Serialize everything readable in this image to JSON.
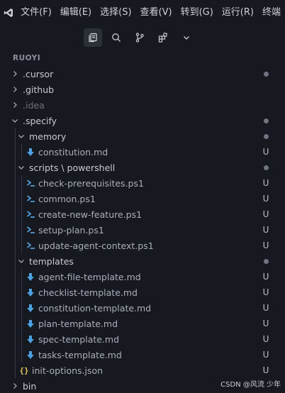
{
  "menubar": {
    "items": [
      "文件(F)",
      "编辑(E)",
      "选择(S)",
      "查看(V)",
      "转到(G)",
      "运行(R)",
      "终端"
    ]
  },
  "toolbar": {
    "icons": [
      "explorer-icon",
      "search-icon",
      "source-control-icon",
      "extensions-icon",
      "chevron-down-icon"
    ]
  },
  "explorer": {
    "title": "RUOYI",
    "rows": [
      {
        "label": ".cursor",
        "type": "folder",
        "open": false,
        "depth": 0,
        "status": "dot",
        "dim": false
      },
      {
        "label": ".github",
        "type": "folder",
        "open": false,
        "depth": 0,
        "status": "",
        "dim": false
      },
      {
        "label": ".idea",
        "type": "folder",
        "open": false,
        "depth": 0,
        "status": "",
        "dim": true
      },
      {
        "label": ".specify",
        "type": "folder",
        "open": true,
        "depth": 0,
        "status": "dot",
        "dim": false
      },
      {
        "label": "memory",
        "type": "folder",
        "open": true,
        "depth": 1,
        "status": "dot",
        "dim": false
      },
      {
        "label": "constitution.md",
        "type": "md",
        "depth": 2,
        "status": "U"
      },
      {
        "label": "scripts \\ powershell",
        "type": "folder",
        "open": true,
        "depth": 1,
        "status": "dot",
        "dim": false
      },
      {
        "label": "check-prerequisites.ps1",
        "type": "ps1",
        "depth": 2,
        "status": "U"
      },
      {
        "label": "common.ps1",
        "type": "ps1",
        "depth": 2,
        "status": "U"
      },
      {
        "label": "create-new-feature.ps1",
        "type": "ps1",
        "depth": 2,
        "status": "U"
      },
      {
        "label": "setup-plan.ps1",
        "type": "ps1",
        "depth": 2,
        "status": "U"
      },
      {
        "label": "update-agent-context.ps1",
        "type": "ps1",
        "depth": 2,
        "status": "U"
      },
      {
        "label": "templates",
        "type": "folder",
        "open": true,
        "depth": 1,
        "status": "dot",
        "dim": false
      },
      {
        "label": "agent-file-template.md",
        "type": "md",
        "depth": 2,
        "status": "U"
      },
      {
        "label": "checklist-template.md",
        "type": "md",
        "depth": 2,
        "status": "U"
      },
      {
        "label": "constitution-template.md",
        "type": "md",
        "depth": 2,
        "status": "U"
      },
      {
        "label": "plan-template.md",
        "type": "md",
        "depth": 2,
        "status": "U"
      },
      {
        "label": "spec-template.md",
        "type": "md",
        "depth": 2,
        "status": "U"
      },
      {
        "label": "tasks-template.md",
        "type": "md",
        "depth": 2,
        "status": "U"
      },
      {
        "label": "init-options.json",
        "type": "json",
        "depth": 1,
        "status": "U"
      },
      {
        "label": "bin",
        "type": "folder",
        "open": false,
        "depth": 0,
        "status": "",
        "dim": false
      }
    ]
  },
  "watermark": "CSDN @风流 少年",
  "colors": {
    "background": "#16191f",
    "md_icon": "#4ea1e0",
    "ps1_icon": "#5aa9e6",
    "json_icon": "#e8c65a",
    "untracked": "#b9bfc7"
  }
}
